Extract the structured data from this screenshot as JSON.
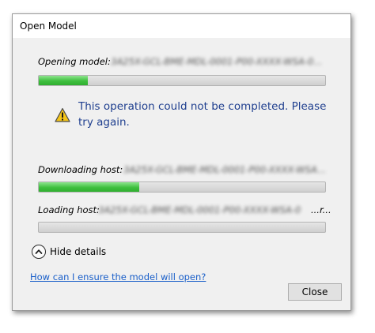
{
  "dialog": {
    "title": "Open Model"
  },
  "opening": {
    "label": "Opening model:",
    "value": "3A25X-GCL-BME-MDL-0001-P00-XXXX-WSA-0...",
    "progress": 0.17
  },
  "warning": {
    "icon": "warning-icon",
    "message": "This operation could not be completed. Please try again.",
    "color": "#1f3f8f"
  },
  "downloading": {
    "label": "Downloading host:",
    "value": "3A25X-GCL-BME-MDL-0001-P00-XXXX-WSA...",
    "progress": 0.35
  },
  "loading": {
    "label": "Loading host:",
    "value": "3A25X-GCL-BME-MDL-0001-P00-XXXX-WSA-0",
    "suffix": "...r...",
    "progress": 0
  },
  "details_toggle": {
    "label": "Hide details",
    "icon": "chevron-up-icon"
  },
  "help_link": {
    "text": "How can I ensure the model will open?",
    "color": "#1a5fc9"
  },
  "buttons": {
    "close_label": "Close"
  },
  "colors": {
    "progress_fill": "#3fbf3f",
    "dialog_bg": "#f0f0f0"
  }
}
